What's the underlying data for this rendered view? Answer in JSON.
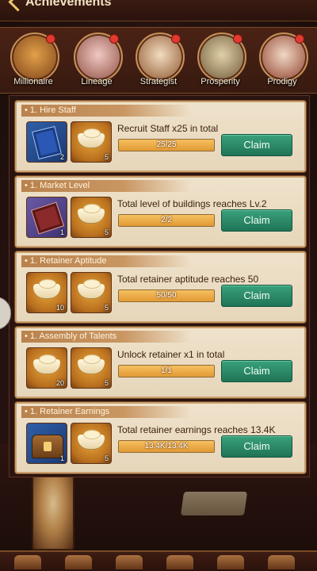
{
  "header": {
    "title": "Achievements"
  },
  "categories": [
    {
      "label": "Millionaire",
      "icon": "money-bag-icon",
      "color": "#b8732f"
    },
    {
      "label": "Lineage",
      "icon": "flower-branch-icon",
      "color": "#c77a86"
    },
    {
      "label": "Strategist",
      "icon": "tactics-board-icon",
      "color": "#9e6d3e"
    },
    {
      "label": "Prosperity",
      "icon": "town-map-icon",
      "color": "#8c7a55"
    },
    {
      "label": "Prodigy",
      "icon": "scroll-book-icon",
      "color": "#b25a3a"
    }
  ],
  "tasks": [
    {
      "header": "• 1. Hire Staff",
      "description": "Recruit Staff x25 in total",
      "progress_text": "25/25",
      "progress": 1.0,
      "claim_label": "Claim",
      "rewards": [
        {
          "icon": "blue-book-icon",
          "qty": "2"
        },
        {
          "icon": "gold-ingot-icon",
          "qty": "5"
        }
      ]
    },
    {
      "header": "• 1. Market Level",
      "description": "Total level of buildings reaches Lv.2",
      "progress_text": "2/2",
      "progress": 1.0,
      "claim_label": "Claim",
      "rewards": [
        {
          "icon": "purple-book-icon",
          "qty": "1"
        },
        {
          "icon": "gold-ingot-icon",
          "qty": "5"
        }
      ]
    },
    {
      "header": "• 1. Retainer Aptitude",
      "description": "Total retainer aptitude reaches 50",
      "progress_text": "50/50",
      "progress": 1.0,
      "claim_label": "Claim",
      "rewards": [
        {
          "icon": "gold-ingot-icon",
          "qty": "10"
        },
        {
          "icon": "gold-ingot-icon",
          "qty": "5"
        }
      ]
    },
    {
      "header": "• 1. Assembly of Talents",
      "description": "Unlock  retainer x1 in total",
      "progress_text": "1/1",
      "progress": 1.0,
      "claim_label": "Claim",
      "rewards": [
        {
          "icon": "gold-ingot-icon",
          "qty": "20"
        },
        {
          "icon": "gold-ingot-icon",
          "qty": "5"
        }
      ]
    },
    {
      "header": "• 1. Retainer Earnings",
      "description": "Total retainer earnings reaches 13.4K",
      "progress_text": "13.4K/13.4K",
      "progress": 1.0,
      "claim_label": "Claim",
      "rewards": [
        {
          "icon": "treasure-chest-icon",
          "qty": "1"
        },
        {
          "icon": "gold-ingot-icon",
          "qty": "5"
        }
      ]
    }
  ]
}
